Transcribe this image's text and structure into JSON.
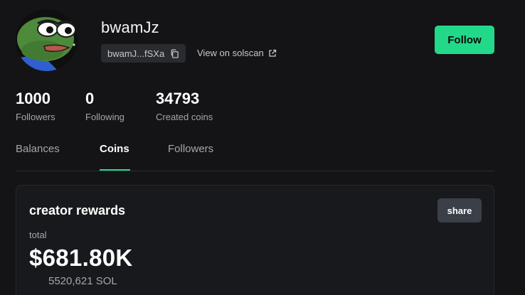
{
  "profile": {
    "username": "bwamJz",
    "address_short": "bwamJ...fSXa",
    "solscan_link": "View on solscan",
    "follow_label": "Follow"
  },
  "stats": [
    {
      "value": "1000",
      "label": "Followers"
    },
    {
      "value": "0",
      "label": "Following"
    },
    {
      "value": "34793",
      "label": "Created coins"
    }
  ],
  "tabs": [
    {
      "label": "Balances",
      "active": false
    },
    {
      "label": "Coins",
      "active": true
    },
    {
      "label": "Followers",
      "active": false
    }
  ],
  "rewards": {
    "title": "creator rewards",
    "share_label": "share",
    "total_label": "total",
    "total_value": "$681.80K",
    "sol_value": "5520,621 SOL"
  },
  "colors": {
    "accent": "#22d98a",
    "background": "#141416",
    "card": "#18191c",
    "muted_text": "#a4a6ab"
  },
  "icons": {
    "avatar": "pepe-frog-avatar",
    "copy": "copy-icon",
    "external": "external-link-icon"
  }
}
